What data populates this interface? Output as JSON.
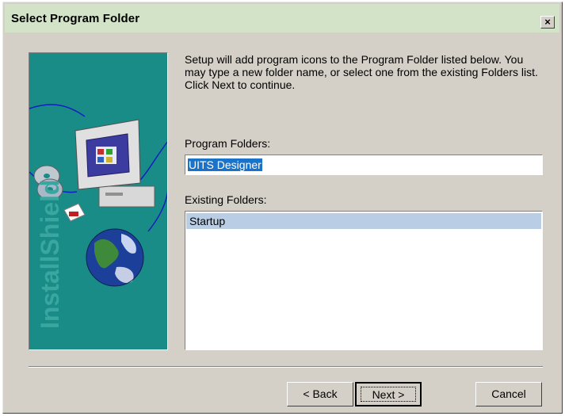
{
  "window": {
    "title": "Select Program Folder",
    "close_label": "×"
  },
  "sidebar": {
    "brand": "InstallShield",
    "icons": [
      "computer-icon",
      "cd-disc-icon",
      "earth-globe-icon"
    ]
  },
  "main": {
    "instructions": "Setup will add program icons to the Program Folder listed below. You may type a new folder name, or select one from the existing Folders list. Click Next to continue.",
    "program_folder_label": "Program Folders:",
    "program_folder_value": "UITS Designer",
    "existing_folders_label": "Existing Folders:",
    "existing_folders": [
      "Startup"
    ]
  },
  "buttons": {
    "back": "< Back",
    "next": "Next >",
    "cancel": "Cancel"
  },
  "colors": {
    "titlebar": "#d3e3c8",
    "side_panel": "#1a8c88",
    "selection": "#1a72c9",
    "list_highlight": "#b9cde5"
  }
}
